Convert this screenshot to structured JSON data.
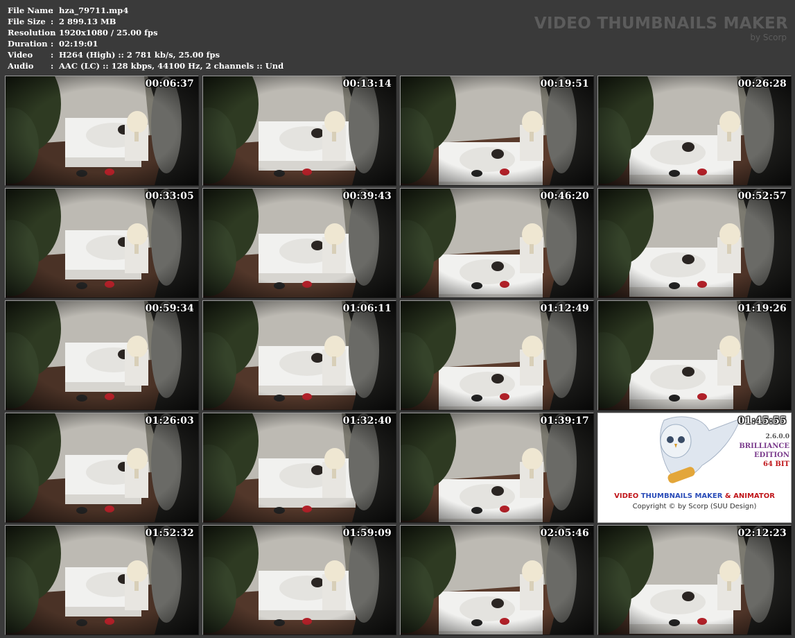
{
  "file_info": [
    {
      "label": "File Name",
      "sep": ":",
      "value": "hza_79711.mp4"
    },
    {
      "label": "File Size",
      "sep": ":",
      "value": "2 899.13 MB"
    },
    {
      "label": "Resolution",
      "sep": ":",
      "value": "1920x1080 / 25.00 fps"
    },
    {
      "label": "Duration",
      "sep": ":",
      "value": "02:19:01"
    },
    {
      "label": "Video",
      "sep": ":",
      "value": "H264 (High) :: 2 781 kb/s, 25.00 fps"
    },
    {
      "label": "Audio",
      "sep": ":",
      "value": "AAC (LC) :: 128 kbps, 44100 Hz, 2 channels :: Und"
    }
  ],
  "brand": {
    "title": "VIDEO THUMBNAILS MAKER",
    "subtitle": "by Scorp"
  },
  "thumbnails": [
    {
      "time": "00:06:37",
      "variant": 0
    },
    {
      "time": "00:13:14",
      "variant": 1
    },
    {
      "time": "00:19:51",
      "variant": 2
    },
    {
      "time": "00:26:28",
      "variant": 3
    },
    {
      "time": "00:33:05",
      "variant": 0
    },
    {
      "time": "00:39:43",
      "variant": 1
    },
    {
      "time": "00:46:20",
      "variant": 2
    },
    {
      "time": "00:52:57",
      "variant": 3
    },
    {
      "time": "00:59:34",
      "variant": 0
    },
    {
      "time": "01:06:11",
      "variant": 1
    },
    {
      "time": "01:12:49",
      "variant": 2
    },
    {
      "time": "01:19:26",
      "variant": 3
    },
    {
      "time": "01:26:03",
      "variant": 0
    },
    {
      "time": "01:32:40",
      "variant": 1
    },
    {
      "time": "01:39:17",
      "variant": 2
    },
    {
      "time": "01:45:55",
      "logo": true
    },
    {
      "time": "01:52:32",
      "variant": 0
    },
    {
      "time": "01:59:09",
      "variant": 1
    },
    {
      "time": "02:05:46",
      "variant": 2
    },
    {
      "time": "02:12:23",
      "variant": 3
    }
  ],
  "logo_tile": {
    "edition_version": "2.6.0.0",
    "edition_line1": "BRILLIANCE",
    "edition_line2": "EDITION",
    "edition_line3": "64 BIT",
    "product_part1": "VIDEO",
    "product_part2": "THUMBNAILS MAKER",
    "product_part3": "& ANIMATOR",
    "copyright": "Copyright © by Scorp (SUU Design)"
  },
  "colors": {
    "background": "#3a3a3a",
    "brand_text": "#5c5c5c",
    "timestamp": "#ffffff"
  }
}
